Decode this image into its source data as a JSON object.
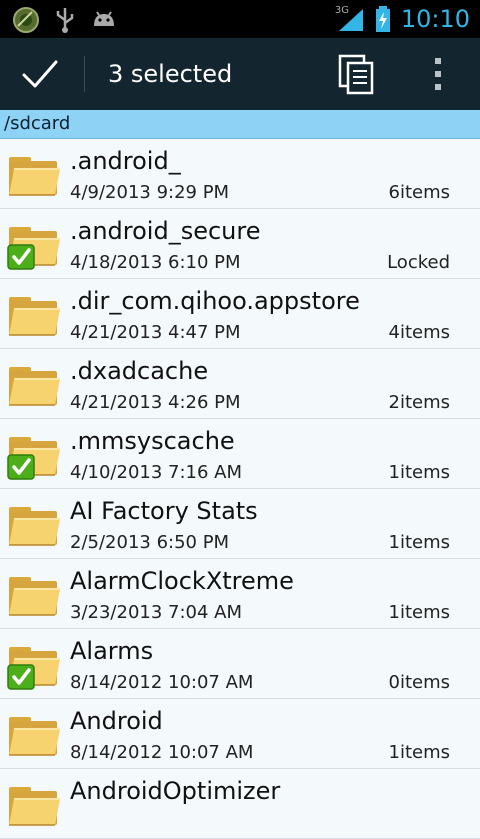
{
  "status_bar": {
    "time": "10:10",
    "network": "3G",
    "icons": [
      "globe-app-icon",
      "usb-icon",
      "android-debug-icon",
      "signal-icon",
      "battery-charging-icon"
    ]
  },
  "action_bar": {
    "title": "3 selected",
    "icons": [
      "checkmark-icon",
      "copy-icon",
      "overflow-menu-icon"
    ]
  },
  "path": "/sdcard",
  "colors": {
    "action_bar": "#13262f",
    "path_bar": "#8ed2f6",
    "accent": "#33b5e5",
    "check_green": "#4caf1a"
  },
  "files": [
    {
      "name": ".android_",
      "date": "4/9/2013 9:29 PM",
      "count": "6items",
      "selected": false
    },
    {
      "name": ".android_secure",
      "date": "4/18/2013 6:10 PM",
      "count": "Locked",
      "selected": true
    },
    {
      "name": ".dir_com.qihoo.appstore",
      "date": "4/21/2013 4:47 PM",
      "count": "4items",
      "selected": false
    },
    {
      "name": ".dxadcache",
      "date": "4/21/2013 4:26 PM",
      "count": "2items",
      "selected": false
    },
    {
      "name": ".mmsyscache",
      "date": "4/10/2013 7:16 AM",
      "count": "1items",
      "selected": true
    },
    {
      "name": "AI Factory Stats",
      "date": "2/5/2013 6:50 PM",
      "count": "1items",
      "selected": false
    },
    {
      "name": "AlarmClockXtreme",
      "date": "3/23/2013 7:04 AM",
      "count": "1items",
      "selected": false
    },
    {
      "name": "Alarms",
      "date": "8/14/2012 10:07 AM",
      "count": "0items",
      "selected": true
    },
    {
      "name": "Android",
      "date": "8/14/2012 10:07 AM",
      "count": "1items",
      "selected": false
    },
    {
      "name": "AndroidOptimizer",
      "date": "",
      "count": "",
      "selected": false
    }
  ]
}
